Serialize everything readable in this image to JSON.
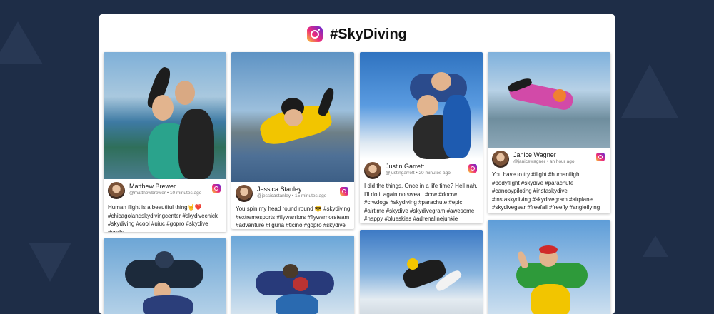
{
  "header": {
    "title": "#SkyDiving",
    "logo_icon": "instagram-icon"
  },
  "colors": {
    "background": "#1e2d47",
    "panel": "#ffffff"
  },
  "posts": [
    {
      "name": "Matthew Brewer",
      "handle": "@matthewbrewer • 10 minutes ago",
      "caption": "Human flight is a beautiful thing🤘❤️#chicagolandskydivingcenter #skydivechick #skydiving #cool #uiuc #gopro #skydive #smile"
    },
    {
      "name": "Jessica Stanley",
      "handle": "@jessicastanley • 15 minutes ago",
      "caption": "You spin my head round round 😎 #skydiving #extremesports #flywarriors #flywarriorsteam #advanture #liguria #ticino #gopro #skydive"
    },
    {
      "name": "Justin Garrett",
      "handle": "@justingarrett • 20 minutes ago",
      "caption": "I did the things. Once in a life time? Hell nah, I'll do it again no sweat. #crw #docrw #crwdogs #skydiving #parachute #epic #airtime #skydive #skydivegram #awesome #happy #blueskies #adrenalinejunkie #extremesports #adrenaline"
    },
    {
      "name": "Janice Wagner",
      "handle": "@janicewagner • an hour ago",
      "caption": "You have to try #flight #humanflight #bodyflight #skydive #parachute #canopypiloting #instaskydive #instaskydiving #skydivegram #airplane #skydivegear #freefall #freefly #angleflying #movement #bodypilot #smile"
    }
  ]
}
